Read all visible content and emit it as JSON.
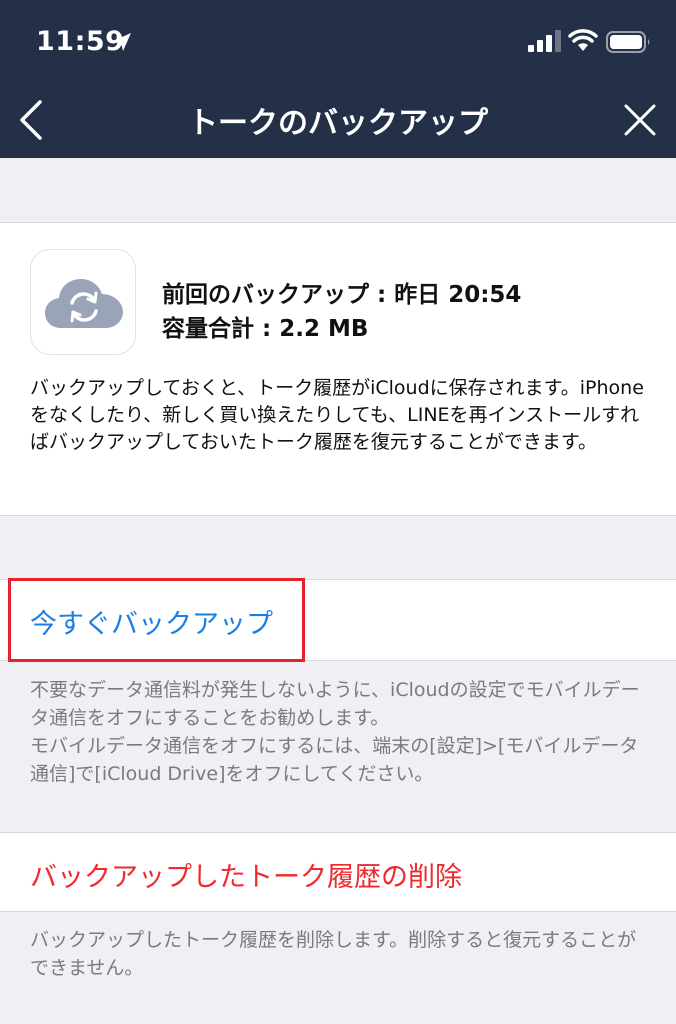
{
  "status_bar": {
    "time": "11:59",
    "icons": [
      "location-icon",
      "signal-icon",
      "wifi-icon",
      "battery-icon"
    ]
  },
  "nav": {
    "title": "トークのバックアップ",
    "back_icon": "chevron-left-icon",
    "close_icon": "close-icon"
  },
  "backup_info": {
    "icon": "cloud-sync-icon",
    "last_backup": "前回のバックアップ : 昨日 20:54",
    "capacity": "容量合計 : 2.2 MB",
    "description": "バックアップしておくと、トーク履歴がiCloudに保存されます。iPhoneをなくしたり、新しく買い換えたりしても、LINEを再インストールすればバックアップしておいたトーク履歴を復元することができます。"
  },
  "backup_now": {
    "label": "今すぐバックアップ",
    "note": "不要なデータ通信料が発生しないように、iCloudの設定でモバイルデータ通信をオフにすることをお勧めします。\nモバイルデータ通信をオフにするには、端末の[設定]>[モバイルデータ通信]で[iCloud Drive]をオフにしてください。"
  },
  "delete": {
    "label": "バックアップしたトーク履歴の削除",
    "note": "バックアップしたトーク履歴を削除します。削除すると復元することができません。"
  },
  "colors": {
    "header_bg": "#233047",
    "page_bg": "#efeff4",
    "link_blue": "#1a7ee6",
    "delete_red": "#ee2a2e",
    "highlight_red": "#e5212c",
    "note_gray": "#7a7a80"
  }
}
